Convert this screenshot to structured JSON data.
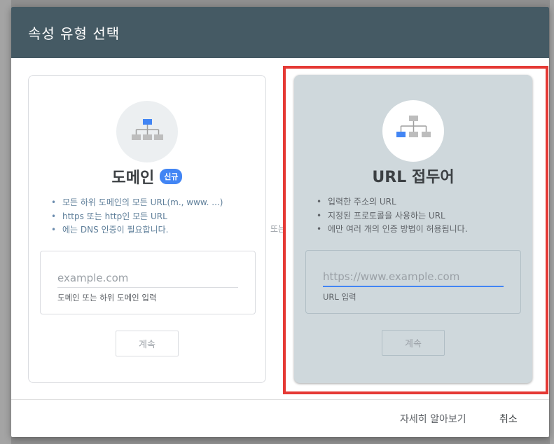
{
  "dialog": {
    "title": "속성 유형 선택"
  },
  "domain_card": {
    "title": "도메인",
    "badge": "신규",
    "features": [
      "모든 하위 도메인의 모든 URL(m., www. ...)",
      "https 또는 http인 모든 URL",
      "에는 DNS 인증이 필요합니다."
    ],
    "input_placeholder": "example.com",
    "input_hint": "도메인 또는 하위 도메인 입력",
    "button_label": "계속",
    "icon": "sitemap-icon"
  },
  "or_label": "또는",
  "url_card": {
    "title": "URL 접두어",
    "features": [
      "입력한 주소의 URL",
      "지정된 프로토콜을 사용하는 URL",
      "에만 여러 개의 인증 방법이 허용됩니다."
    ],
    "input_placeholder": "https://www.example.com",
    "input_hint": "URL 입력",
    "button_label": "계속",
    "icon": "sitemap-icon"
  },
  "footer": {
    "learn_more": "자세히 알아보기",
    "cancel": "취소"
  },
  "colors": {
    "header_bg": "#455a64",
    "accent": "#4285f4",
    "highlight": "#e53935",
    "selected_card_bg": "#cfd8dc"
  }
}
